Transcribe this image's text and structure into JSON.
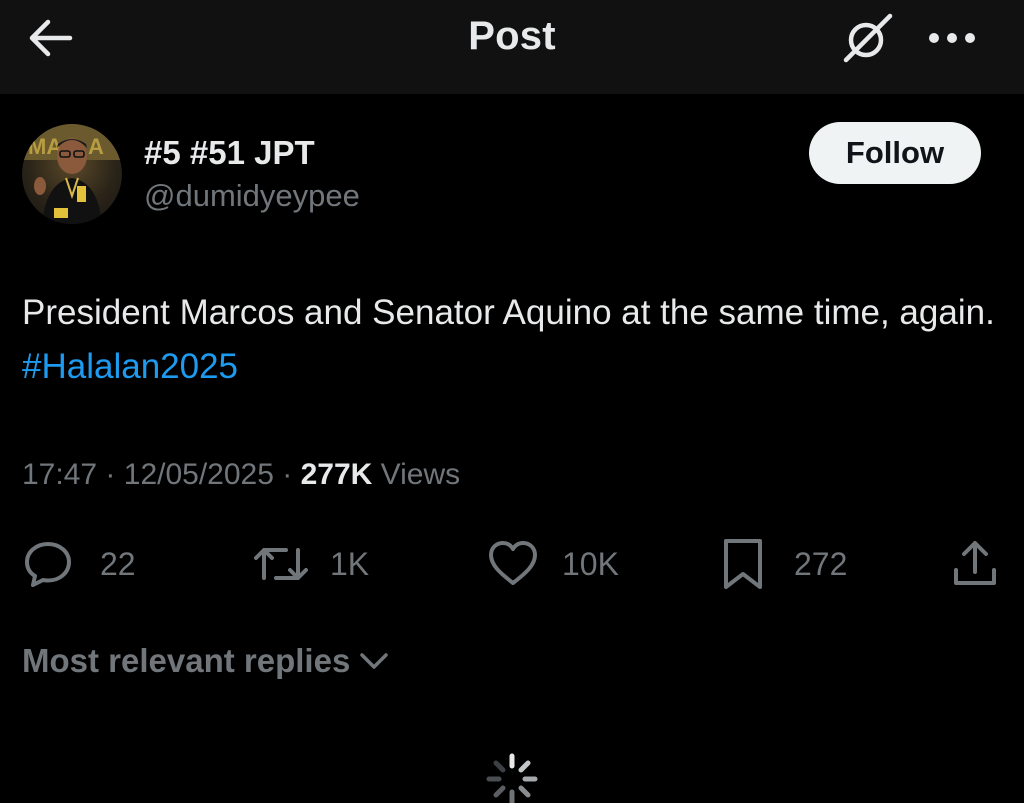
{
  "header": {
    "title": "Post",
    "back_icon": "arrow-left-icon",
    "grok_icon": "grok-icon",
    "more_icon": "more-horizontal-icon"
  },
  "author": {
    "display_name": "#5 #51 JPT",
    "handle": "@dumidyeypee",
    "avatar_icon": "user-avatar",
    "follow_label": "Follow"
  },
  "post": {
    "text_line": "President Marcos and Senator Aquino at the same time, again.",
    "hashtag": "#Halalan2025",
    "time": "17:47",
    "separator": "·",
    "date": "12/05/2025",
    "views_count": "277K",
    "views_label": "Views"
  },
  "actions": {
    "replies": "22",
    "reposts": "1K",
    "likes": "10K",
    "bookmarks": "272"
  },
  "replies_filter": {
    "label": "Most relevant replies"
  },
  "colors": {
    "background": "#000000",
    "header_bg": "#111111",
    "text_primary": "#e7e9ea",
    "text_secondary": "#71767b",
    "link": "#1d9bf0",
    "follow_bg": "#eff3f4"
  }
}
